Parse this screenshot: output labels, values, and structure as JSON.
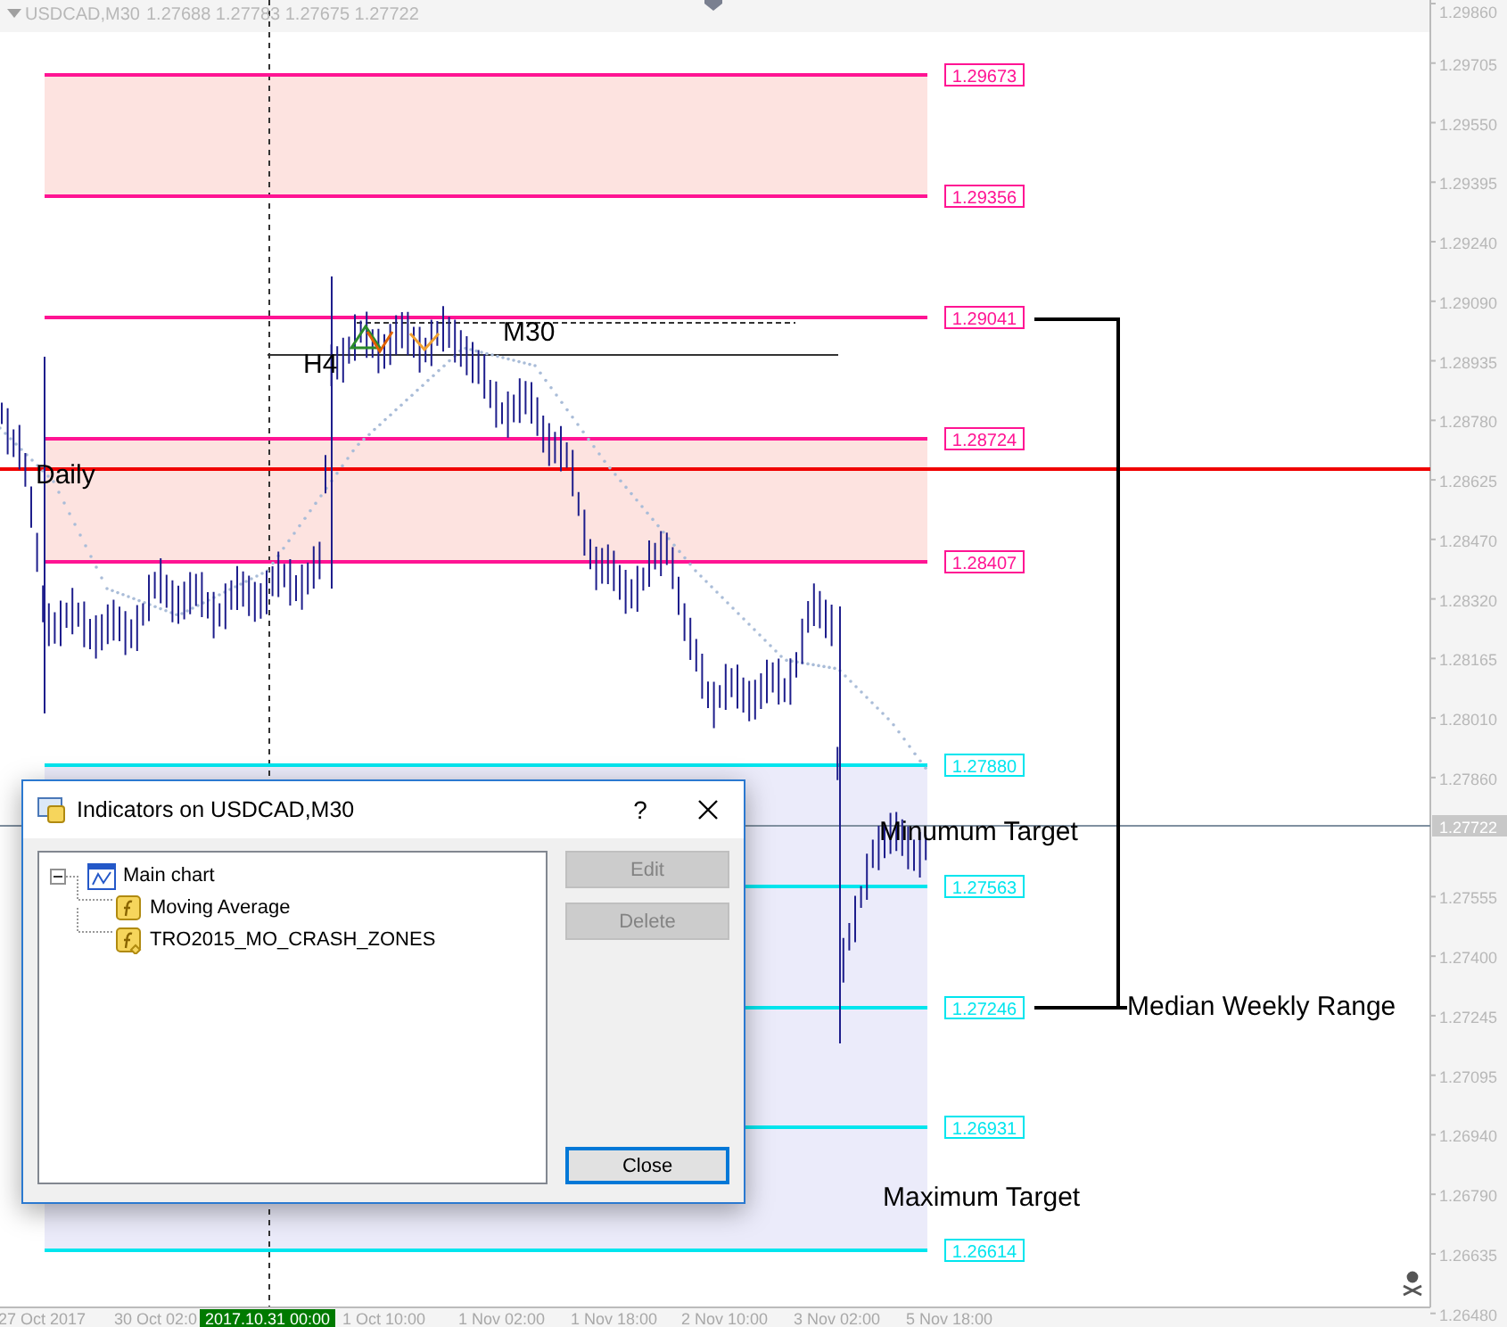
{
  "header": {
    "symbol": "USDCAD,M30",
    "quotes": "1.27688 1.27783 1.27675 1.27722"
  },
  "price_axis": {
    "ticks": [
      "1.29860",
      "1.29705",
      "1.29550",
      "1.29395",
      "1.29240",
      "1.29090",
      "1.28935",
      "1.28780",
      "1.28625",
      "1.28470",
      "1.28320",
      "1.28165",
      "1.28010",
      "1.27860",
      "1.27555",
      "1.27400",
      "1.27245",
      "1.27095",
      "1.26940",
      "1.26790",
      "1.26635",
      "1.26480"
    ],
    "current": "1.27722"
  },
  "time_axis": [
    {
      "text": "27 Oct 2017",
      "selected": false
    },
    {
      "text": "30 Oct 02:0",
      "selected": false
    },
    {
      "text": "2017.10.31 00:00",
      "selected": true
    },
    {
      "text": "1 Oct 10:00",
      "selected": false
    },
    {
      "text": "1 Nov 02:00",
      "selected": false
    },
    {
      "text": "1 Nov 18:00",
      "selected": false
    },
    {
      "text": "2 Nov 10:00",
      "selected": false
    },
    {
      "text": "3 Nov 02:00",
      "selected": false
    },
    {
      "text": "5 Nov 18:00",
      "selected": false
    }
  ],
  "levels": [
    {
      "label": "1.29673",
      "color": "#ff1493"
    },
    {
      "label": "1.29356",
      "color": "#ff1493"
    },
    {
      "label": "1.29041",
      "color": "#ff1493"
    },
    {
      "label": "1.28724",
      "color": "#ff1493"
    },
    {
      "label": "1.28407",
      "color": "#ff1493"
    },
    {
      "label": "1.27880",
      "color": "#00e5ee"
    },
    {
      "label": "1.27563",
      "color": "#00e5ee"
    },
    {
      "label": "1.27246",
      "color": "#00e5ee"
    },
    {
      "label": "1.26931",
      "color": "#00e5ee"
    },
    {
      "label": "1.26614",
      "color": "#00e5ee"
    }
  ],
  "annotations": [
    "Daily",
    "H4",
    "M30",
    "Minumum Target",
    "Median Weekly Range",
    "Maximum Target"
  ],
  "dialog": {
    "title": "Indicators on USDCAD,M30",
    "help": "?",
    "tree": [
      {
        "label": "Main chart",
        "expanded": true,
        "children": [
          {
            "label": "Moving Average",
            "kind": "indicator"
          },
          {
            "label": "TRO2015_MO_CRASH_ZONES",
            "kind": "custom"
          }
        ]
      }
    ],
    "buttons": [
      {
        "label": "Edit",
        "disabled": true,
        "default": false
      },
      {
        "label": "Delete",
        "disabled": true,
        "default": false
      },
      {
        "label": "Close",
        "disabled": false,
        "default": true
      }
    ]
  }
}
